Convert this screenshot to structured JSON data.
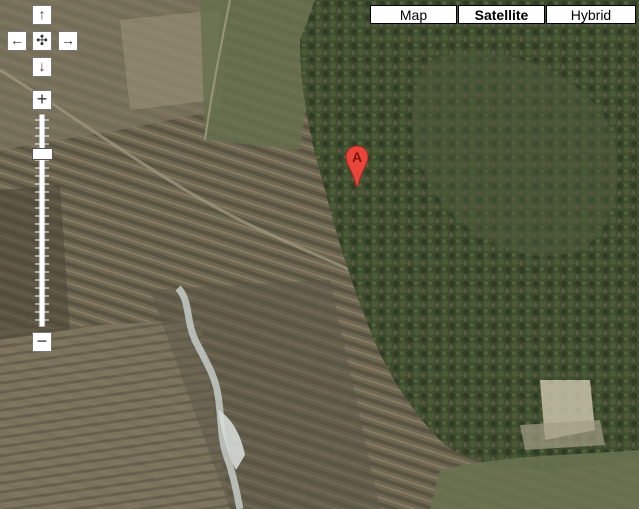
{
  "map_types": {
    "map_label": "Map",
    "satellite_label": "Satellite",
    "hybrid_label": "Hybrid",
    "active": "Satellite"
  },
  "pan": {
    "up_icon": "arrow-up-icon",
    "left_icon": "arrow-left-icon",
    "center_icon": "pan-center-icon",
    "right_icon": "arrow-right-icon",
    "down_icon": "arrow-down-icon"
  },
  "zoom": {
    "in_label": "+",
    "out_label": "−",
    "level_fraction": 0.83
  },
  "marker": {
    "label": "A",
    "color": "#e8463a"
  },
  "colors": {
    "fields": "#6d654f",
    "forest": "#3c4a2c",
    "water": "#c4ccc8"
  }
}
